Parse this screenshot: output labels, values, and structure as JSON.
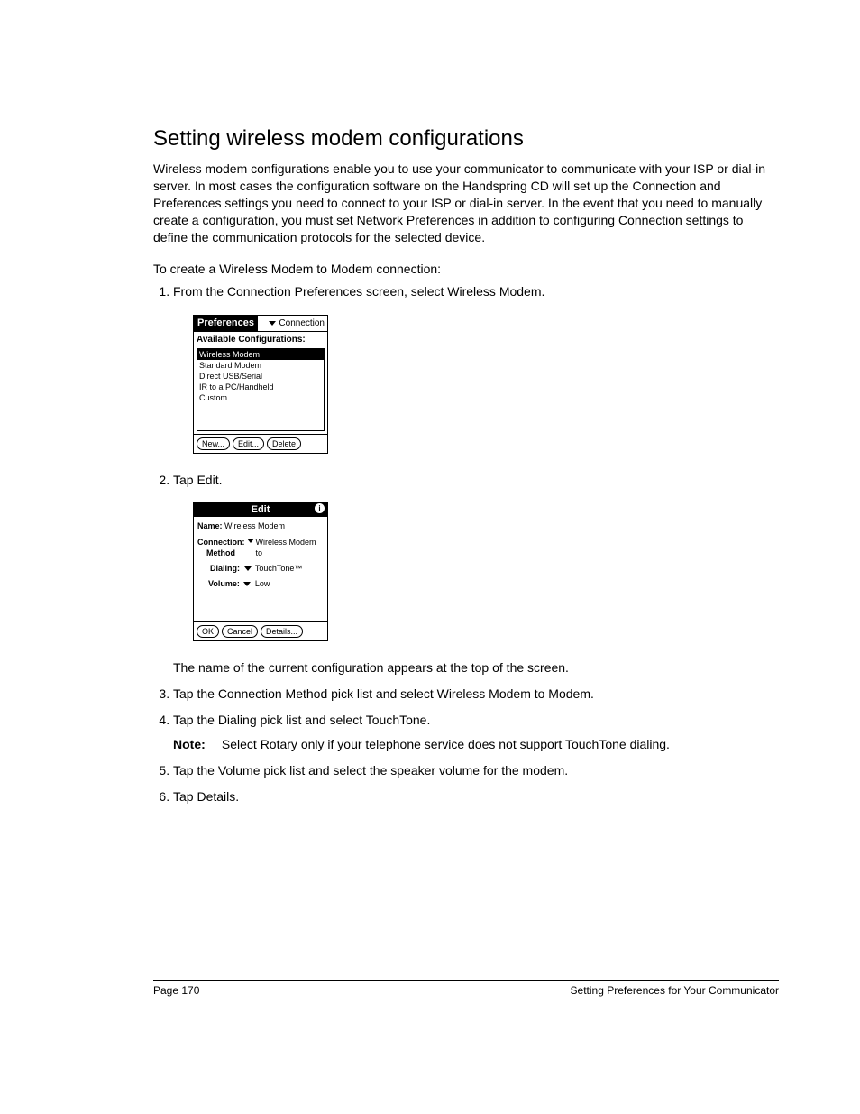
{
  "heading": "Setting wireless modem configurations",
  "intro": "Wireless modem configurations enable you to use your communicator to communicate with your ISP or dial-in server. In most cases the configuration software on the Handspring CD will set up the Connection and Preferences settings you need to connect to your ISP or dial-in server. In the event that you need to manually create a configuration, you must set Network Preferences in addition to configuring Connection settings to define the communication protocols for the selected device.",
  "subhead": "To create a Wireless Modem to Modem connection:",
  "steps": {
    "s1": "From the Connection Preferences screen, select Wireless Modem.",
    "s2": "Tap Edit.",
    "s2_after": "The name of the current configuration appears at the top of the screen.",
    "s3": "Tap the Connection Method pick list and select Wireless Modem to Modem.",
    "s4": "Tap the Dialing pick list and select TouchTone.",
    "note_label": "Note:",
    "note_text": "Select Rotary only if your telephone service does not support TouchTone dialing.",
    "s5": "Tap the Volume pick list and select the speaker volume for the modem.",
    "s6": "Tap Details."
  },
  "screenshot1": {
    "title": "Preferences",
    "menu": "Connection",
    "list_label": "Available Configurations:",
    "items": [
      "Wireless Modem",
      "Standard Modem",
      "Direct USB/Serial",
      "IR to a PC/Handheld",
      "Custom"
    ],
    "buttons": [
      "New...",
      "Edit...",
      "Delete"
    ]
  },
  "screenshot2": {
    "title": "Edit",
    "name_label": "Name:",
    "name_value": "Wireless Modem",
    "conn_label": "Connection:",
    "conn_method_label": "Method",
    "conn_value": "Wireless Modem to",
    "dialing_label": "Dialing:",
    "dialing_value": "TouchTone™",
    "volume_label": "Volume:",
    "volume_value": "Low",
    "buttons": [
      "OK",
      "Cancel",
      "Details..."
    ]
  },
  "footer": {
    "left": "Page 170",
    "right": "Setting Preferences for Your Communicator"
  }
}
